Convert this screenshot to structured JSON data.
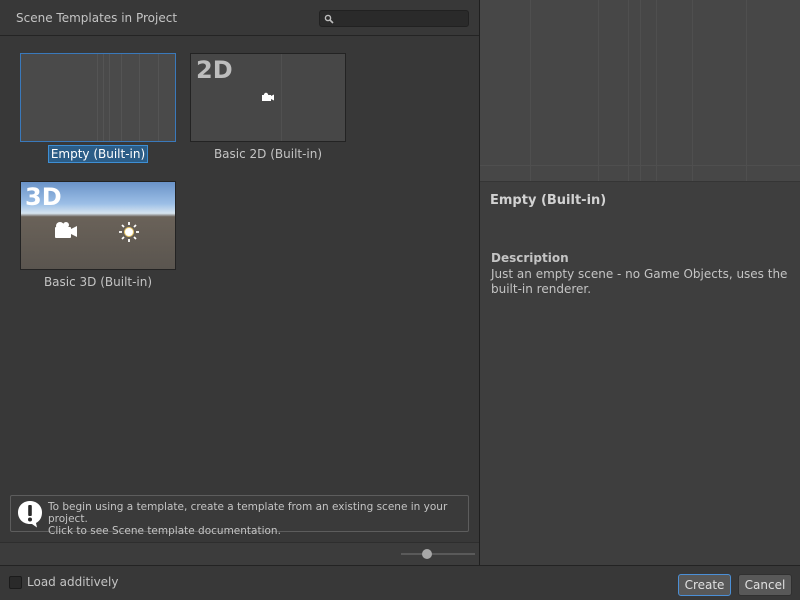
{
  "header": {
    "title": "Scene Templates in Project",
    "search_placeholder": ""
  },
  "templates": [
    {
      "label": "Empty (Built-in)",
      "thumb_text": "",
      "selected": true
    },
    {
      "label": "Basic 2D (Built-in)",
      "thumb_text": "2D",
      "selected": false
    },
    {
      "label": "Basic 3D (Built-in)",
      "thumb_text": "3D",
      "selected": false
    }
  ],
  "info": {
    "line1": "To begin using a template, create a template from an existing scene in your project.",
    "line2": "Click to see Scene template documentation.",
    "icon": "warning-exclamation-icon"
  },
  "zoom": {
    "value_fraction": 0.35
  },
  "details": {
    "title": "Empty (Built-in)",
    "description_heading": "Description",
    "description_text": "Just an empty scene - no Game Objects, uses the built-in renderer."
  },
  "footer": {
    "load_additively_label": "Load additively",
    "load_additively_checked": false,
    "create_label": "Create",
    "cancel_label": "Cancel"
  },
  "colors": {
    "selection_blue": "#2c5d87",
    "accent_border": "#4b8fd6",
    "panel_bg": "#383838"
  }
}
